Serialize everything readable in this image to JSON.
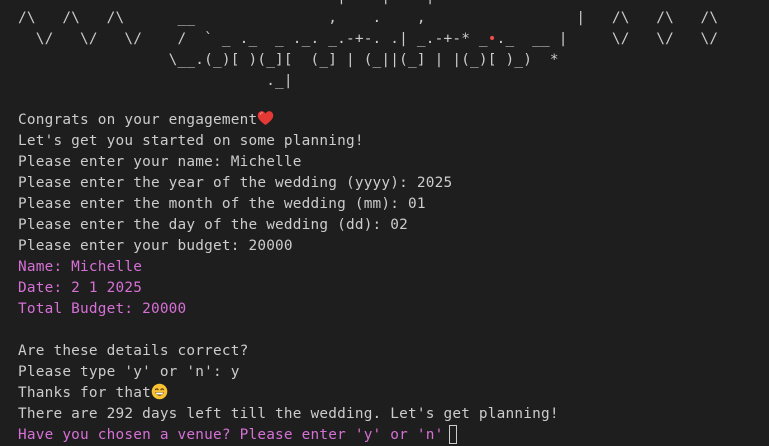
{
  "banner": {
    "line0": "                                    |    |    |                              ",
    "line1_pre": "/\\   /\\   /\\      __               ,    .    ,                 |   /\\   /\\   /\\",
    "line2_a": "  \\/   \\/   \\/    /  ` _ ._  _ ._. _.-+-. .| _.-+-* _",
    "line2_dot": "•",
    "line2_b": "._  __ |     \\/   \\/   \\/",
    "line3": "                 \\__.(_)[ )(_][  (_] | (_||(_] | |(_)[ )_)  *",
    "line4": "                            ._|"
  },
  "lines": {
    "congrats": "Congrats on your engagement",
    "start_planning": "Let's get you started on some planning!",
    "name_prompt": "Please enter your name: Michelle",
    "year_prompt": "Please enter the year of the wedding (yyyy): 2025",
    "month_prompt": "Please enter the month of the wedding (mm): 01",
    "day_prompt": "Please enter the day of the wedding (dd): 02",
    "budget_prompt": "Please enter your budget: 20000",
    "name_out": "Name: Michelle",
    "date_out": "Date: 2 1 2025",
    "budget_out": "Total Budget: 20000",
    "confirm_q": "Are these details correct?",
    "type_prompt": "Please type 'y' or 'n': y",
    "thanks": "Thanks for that",
    "days_left": "There are 292 days left till the wedding. Let's get planning!",
    "venue_prompt": "Have you chosen a venue? Please enter 'y' or 'n'"
  },
  "icons": {
    "heart": "red-heart-icon",
    "grin": "grinning-face-icon",
    "cursor": "terminal-cursor"
  },
  "colors": {
    "background": "#1e1e1e",
    "text": "#cccccc",
    "magenta": "#d670d6",
    "heart": "#e53935",
    "grin": "#f9c232"
  }
}
